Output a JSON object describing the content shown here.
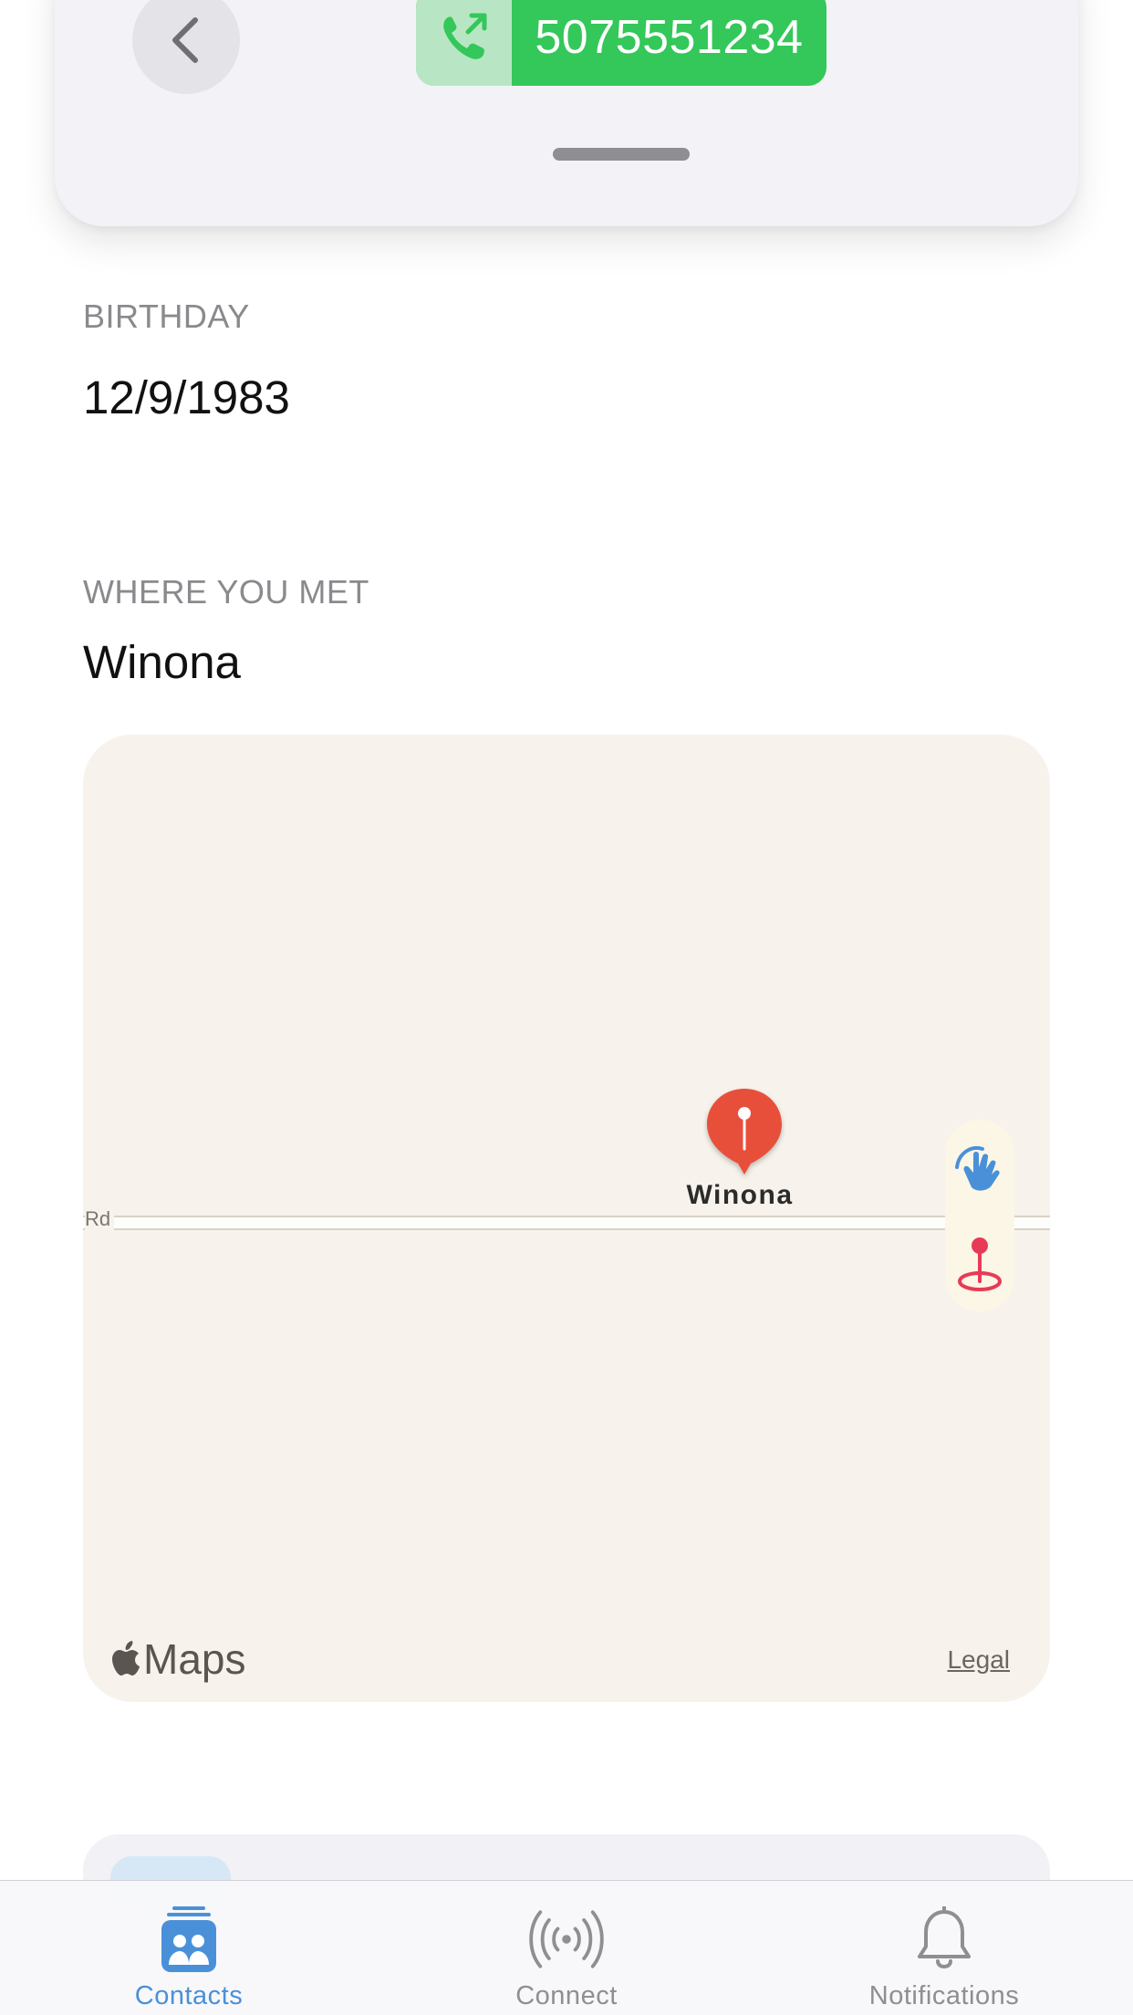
{
  "header": {
    "phone_number": "5075551234"
  },
  "birthday": {
    "label": "BIRTHDAY",
    "value": "12/9/1983"
  },
  "where_met": {
    "label": "WHERE YOU MET",
    "value": "Winona"
  },
  "map": {
    "pin_label": "Winona",
    "road_label": "Rd",
    "brand": "Maps",
    "legal": "Legal",
    "pin_color": "#e8503a",
    "background_color": "#f7f3ec"
  },
  "tabbar": {
    "tabs": [
      {
        "label": "Contacts",
        "icon": "contacts-icon",
        "active": true
      },
      {
        "label": "Connect",
        "icon": "broadcast-icon",
        "active": false
      },
      {
        "label": "Notifications",
        "icon": "bell-icon",
        "active": false
      }
    ]
  },
  "colors": {
    "accent": "#4a90d9",
    "call_green": "#34c759"
  }
}
